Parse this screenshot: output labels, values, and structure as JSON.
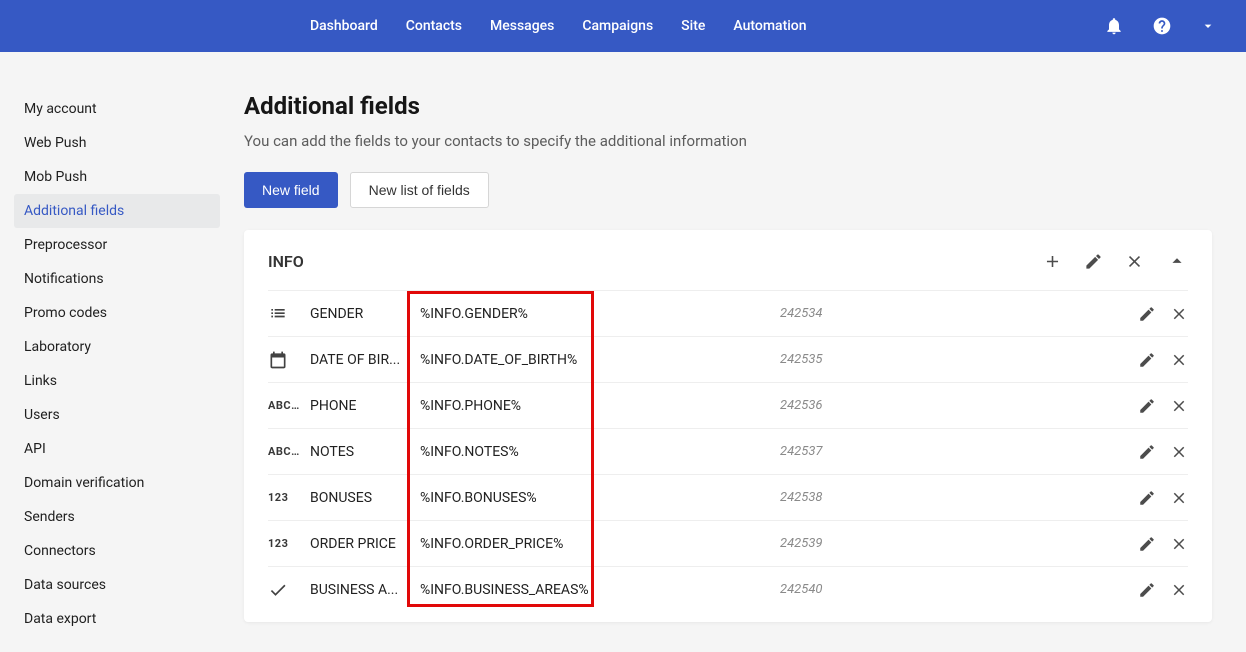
{
  "topnav": {
    "items": [
      "Dashboard",
      "Contacts",
      "Messages",
      "Campaigns",
      "Site",
      "Automation"
    ]
  },
  "sidebar": {
    "items": [
      {
        "label": "My account",
        "active": false
      },
      {
        "label": "Web Push",
        "active": false
      },
      {
        "label": "Mob Push",
        "active": false
      },
      {
        "label": "Additional fields",
        "active": true
      },
      {
        "label": "Preprocessor",
        "active": false
      },
      {
        "label": "Notifications",
        "active": false
      },
      {
        "label": "Promo codes",
        "active": false
      },
      {
        "label": "Laboratory",
        "active": false
      },
      {
        "label": "Links",
        "active": false
      },
      {
        "label": "Users",
        "active": false
      },
      {
        "label": "API",
        "active": false
      },
      {
        "label": "Domain verification",
        "active": false
      },
      {
        "label": "Senders",
        "active": false
      },
      {
        "label": "Connectors",
        "active": false
      },
      {
        "label": "Data sources",
        "active": false
      },
      {
        "label": "Data export",
        "active": false
      }
    ]
  },
  "page": {
    "title": "Additional fields",
    "subtitle": "You can add the fields to your contacts to specify the additional information",
    "new_field_btn": "New field",
    "new_list_btn": "New list of fields"
  },
  "group": {
    "title": "INFO",
    "rows": [
      {
        "type": "list",
        "name": "GENDER",
        "key": "%INFO.GENDER%",
        "id": "242534"
      },
      {
        "type": "date",
        "name": "DATE OF BIR...",
        "key": "%INFO.DATE_OF_BIRTH%",
        "id": "242535"
      },
      {
        "type": "text",
        "name": "PHONE",
        "key": "%INFO.PHONE%",
        "id": "242536"
      },
      {
        "type": "text",
        "name": "NOTES",
        "key": "%INFO.NOTES%",
        "id": "242537"
      },
      {
        "type": "num",
        "name": "BONUSES",
        "key": "%INFO.BONUSES%",
        "id": "242538"
      },
      {
        "type": "num",
        "name": "ORDER PRICE",
        "key": "%INFO.ORDER_PRICE%",
        "id": "242539"
      },
      {
        "type": "check",
        "name": "BUSINESS A...",
        "key": "%INFO.BUSINESS_AREAS%",
        "id": "242540"
      }
    ]
  }
}
